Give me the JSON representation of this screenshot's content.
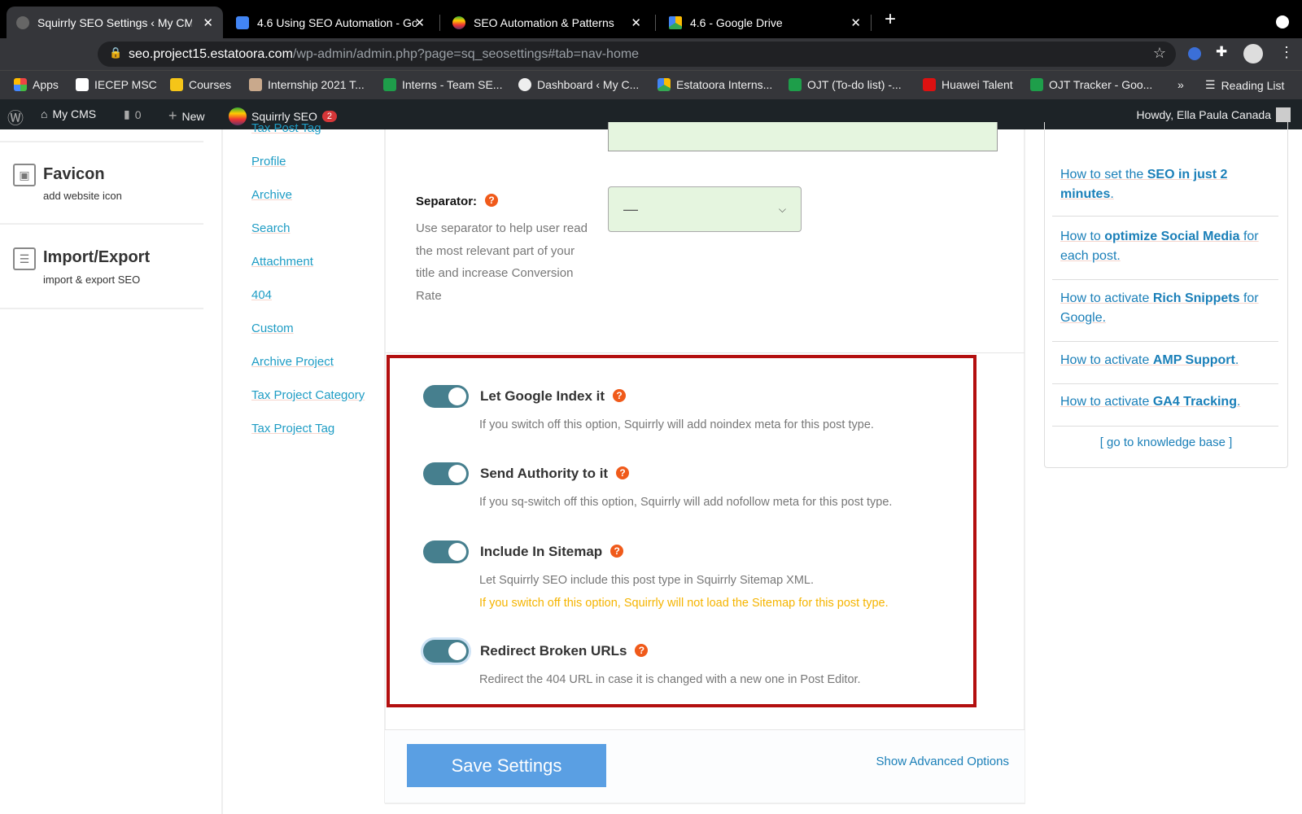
{
  "browser": {
    "tabs": [
      {
        "title": "Squirrly SEO Settings ‹ My CMS",
        "active": true
      },
      {
        "title": "4.6 Using SEO Automation - Go"
      },
      {
        "title": "SEO Automation & Patterns"
      },
      {
        "title": "4.6 - Google Drive"
      }
    ],
    "new_tab": "+",
    "url_host": "seo.project15.estatoora.com",
    "url_path": "/wp-admin/admin.php?page=sq_seosettings#tab=nav-home",
    "bookmarks": [
      "Apps",
      "IECEP MSC",
      "Courses",
      "Internship 2021 T...",
      "Interns - Team SE...",
      "Dashboard ‹ My C...",
      "Estatoora Interns...",
      "OJT (To-do list) -...",
      "Huawei Talent",
      "OJT Tracker - Goo..."
    ],
    "bookmarks_more": "»",
    "reading_list": "Reading List"
  },
  "wpbar": {
    "site": "My CMS",
    "comments": "0",
    "new": "New",
    "plugin": "Squirrly SEO",
    "plugin_badge": "2",
    "howdy": "Howdy, Ella Paula Canada"
  },
  "left_menu": [
    {
      "title": "Favicon",
      "subtitle": "add website icon",
      "icon": "image-icon"
    },
    {
      "title": "Import/Export",
      "subtitle": "import & export SEO",
      "icon": "sliders-icon"
    }
  ],
  "post_types": [
    "Tax Post Tag",
    "Profile",
    "Archive",
    "Search",
    "Attachment",
    "404",
    "Custom",
    "Archive Project",
    "Tax Project Category",
    "Tax Project Tag"
  ],
  "separator": {
    "label": "Separator:",
    "description_lines": [
      "Use separator to help user read",
      "the most relevant part of your",
      "title and increase Conversion",
      "Rate"
    ],
    "value": "—"
  },
  "toggles": [
    {
      "label": "Let Google Index it",
      "on": true,
      "description": "If you switch off this option, Squirrly will add noindex meta for this post type."
    },
    {
      "label": "Send Authority to it",
      "on": true,
      "description": "If you sq-switch off this option, Squirrly will add nofollow meta for this post type."
    },
    {
      "label": "Include In Sitemap",
      "on": true,
      "description": "Let Squirrly SEO include this post type in Squirrly Sitemap XML.",
      "warning": "If you switch off this option, Squirrly will not load the Sitemap for this post type."
    },
    {
      "label": "Redirect Broken URLs",
      "on": true,
      "description": "Redirect the 404 URL in case it is changed with a new one in Post Editor."
    }
  ],
  "help_glyph": "?",
  "footer": {
    "save": "Save Settings",
    "advanced": "Show Advanced Options"
  },
  "knowledge": {
    "items": [
      {
        "pre": "How to set the ",
        "bold": "SEO in just 2 minutes",
        "post": "."
      },
      {
        "pre": "How to ",
        "bold": "optimize Social Media",
        "post": " for each post."
      },
      {
        "pre": "How to activate ",
        "bold": "Rich Snippets",
        "post": " for Google."
      },
      {
        "pre": "How to activate ",
        "bold": "AMP Support",
        "post": "."
      },
      {
        "pre": "How to activate ",
        "bold": "GA4 Tracking",
        "post": "."
      }
    ],
    "more": "[ go to knowledge base ]"
  },
  "colors": {
    "highlight_box": "#b30f0f",
    "toggle_on": "#467f8e",
    "link": "#1e9cc4",
    "save_button": "#5a9fe3",
    "warning": "#f5b400",
    "help": "#f05a1a"
  }
}
